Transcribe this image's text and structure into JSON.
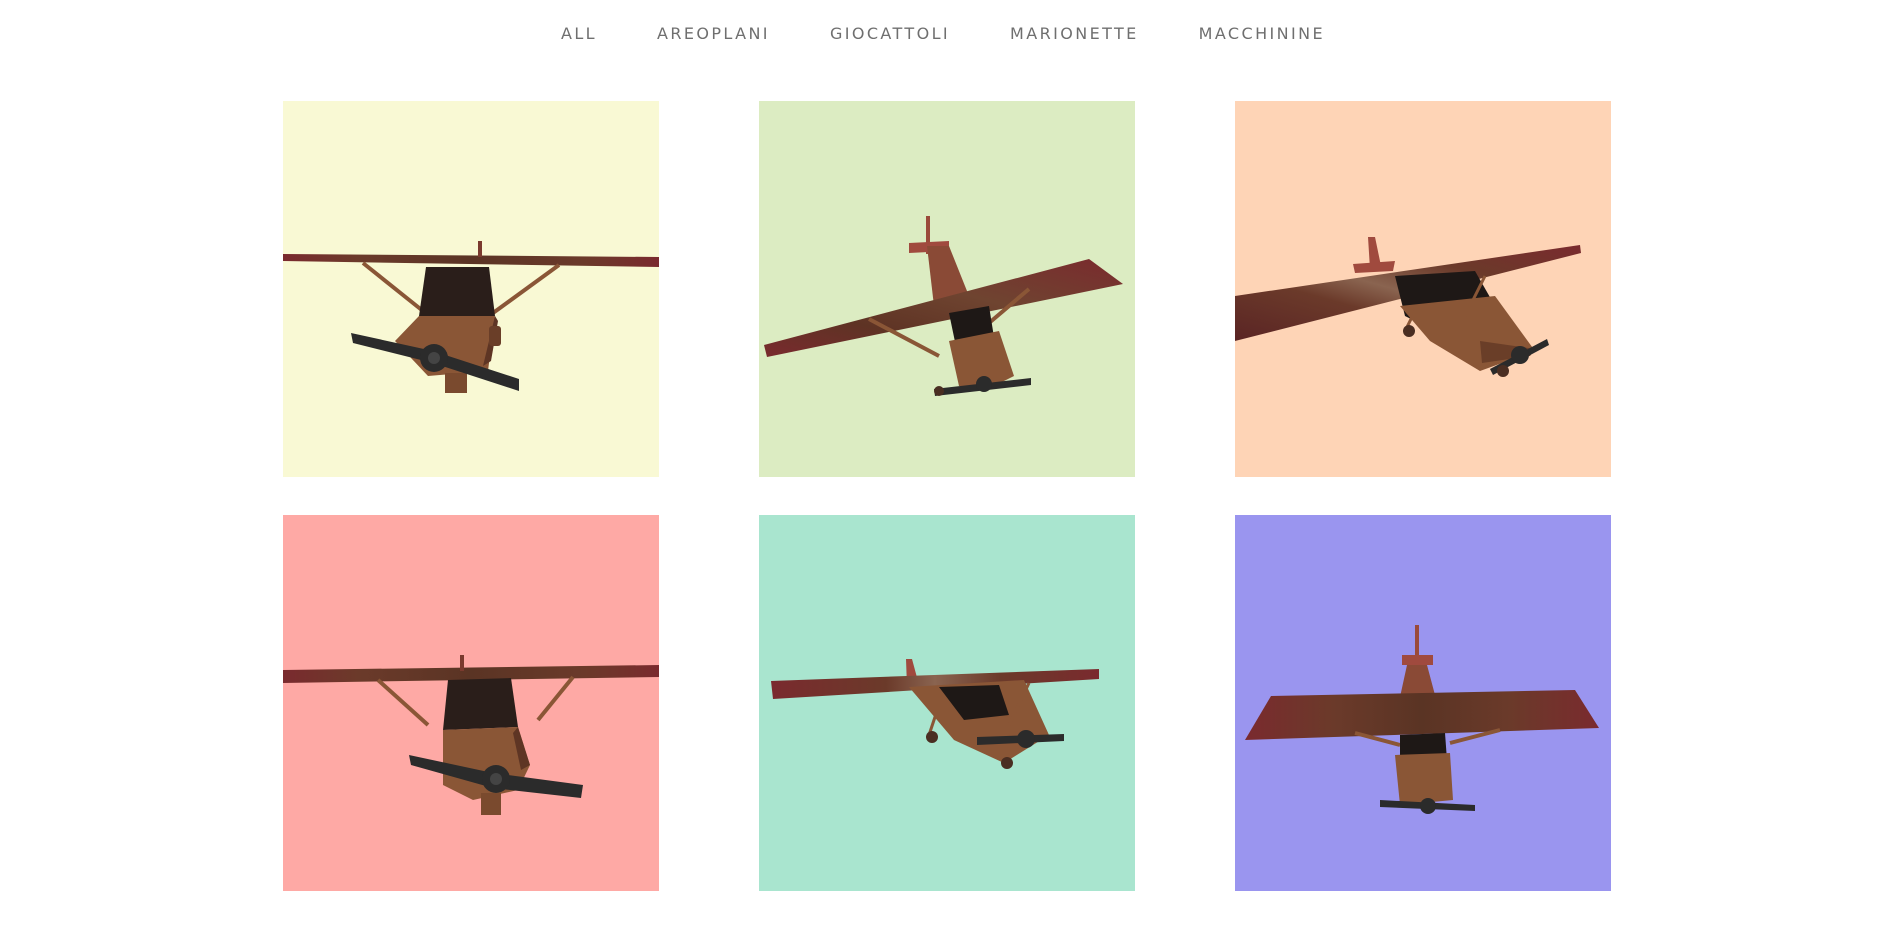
{
  "nav": {
    "filters": [
      {
        "label": "ALL"
      },
      {
        "label": "AREOPLANI"
      },
      {
        "label": "GIOCATTOLI"
      },
      {
        "label": "MARIONETTE"
      },
      {
        "label": "MACCHININE"
      }
    ]
  },
  "gallery": {
    "tiles": [
      {
        "background": "#f9f9d4",
        "icon": "wooden-airplane-front-view"
      },
      {
        "background": "#dcecc2",
        "icon": "wooden-airplane-three-quarter-view"
      },
      {
        "background": "#fed4b6",
        "icon": "wooden-airplane-side-view"
      },
      {
        "background": "#fea9a5",
        "icon": "wooden-airplane-front-view"
      },
      {
        "background": "#a9e5cf",
        "icon": "wooden-airplane-side-view"
      },
      {
        "background": "#9a95ef",
        "icon": "wooden-airplane-top-view"
      }
    ]
  },
  "colors": {
    "wood": "#8a5636",
    "wing": "#6b3a2a",
    "wing_tip": "#7a2a2e",
    "propeller": "#2b2b2b",
    "window": "#1a1a1a"
  }
}
